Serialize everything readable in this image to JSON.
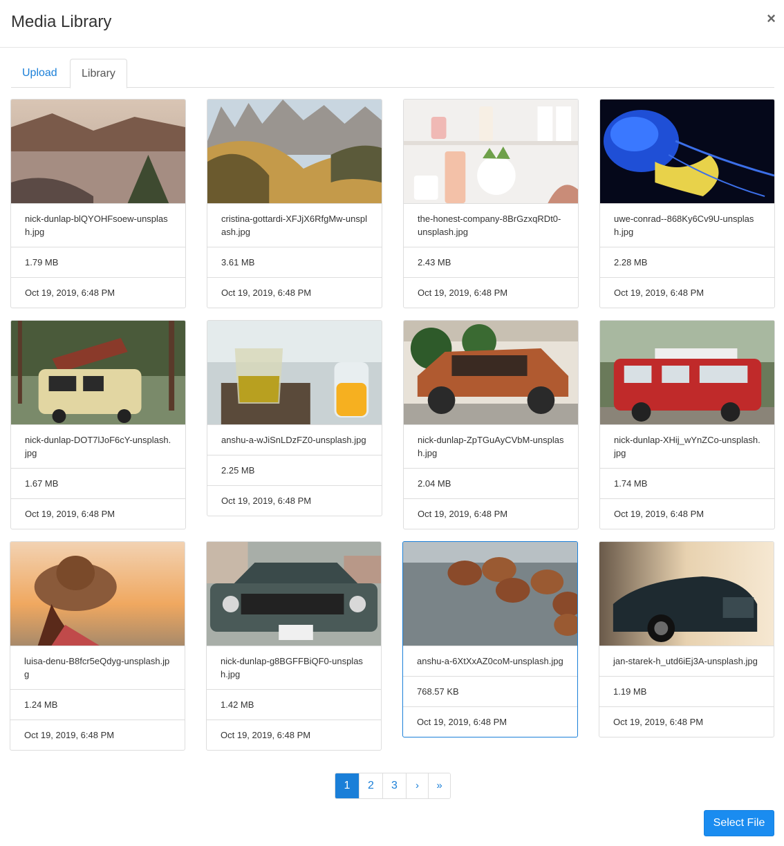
{
  "modal": {
    "title": "Media Library",
    "close_label": "×"
  },
  "tabs": [
    {
      "label": "Upload"
    },
    {
      "label": "Library"
    }
  ],
  "items": [
    {
      "name": "nick-dunlap-blQYOHFsoew-unsplash.jpg",
      "size": "1.79 MB",
      "date": "Oct 19, 2019, 6:48 PM"
    },
    {
      "name": "cristina-gottardi-XFJjX6RfgMw-unsplash.jpg",
      "size": "3.61 MB",
      "date": "Oct 19, 2019, 6:48 PM"
    },
    {
      "name": "the-honest-company-8BrGzxqRDt0-unsplash.jpg",
      "size": "2.43 MB",
      "date": "Oct 19, 2019, 6:48 PM"
    },
    {
      "name": "uwe-conrad--868Ky6Cv9U-unsplash.jpg",
      "size": "2.28 MB",
      "date": "Oct 19, 2019, 6:48 PM"
    },
    {
      "name": "nick-dunlap-DOT7lJoF6cY-unsplash.jpg",
      "size": "1.67 MB",
      "date": "Oct 19, 2019, 6:48 PM"
    },
    {
      "name": "anshu-a-wJiSnLDzFZ0-unsplash.jpg",
      "size": "2.25 MB",
      "date": "Oct 19, 2019, 6:48 PM"
    },
    {
      "name": "nick-dunlap-ZpTGuAyCVbM-unsplash.jpg",
      "size": "2.04 MB",
      "date": "Oct 19, 2019, 6:48 PM"
    },
    {
      "name": "nick-dunlap-XHij_wYnZCo-unsplash.jpg",
      "size": "1.74 MB",
      "date": "Oct 19, 2019, 6:48 PM"
    },
    {
      "name": "luisa-denu-B8fcr5eQdyg-unsplash.jpg",
      "size": "1.24 MB",
      "date": "Oct 19, 2019, 6:48 PM"
    },
    {
      "name": "nick-dunlap-g8BGFFBiQF0-unsplash.jpg",
      "size": "1.42 MB",
      "date": "Oct 19, 2019, 6:48 PM"
    },
    {
      "name": "anshu-a-6XtXxAZ0coM-unsplash.jpg",
      "size": "768.57 KB",
      "date": "Oct 19, 2019, 6:48 PM"
    },
    {
      "name": "jan-starek-h_utd6iEj3A-unsplash.jpg",
      "size": "1.19 MB",
      "date": "Oct 19, 2019, 6:48 PM"
    }
  ],
  "pagination": {
    "pages": [
      "1",
      "2",
      "3"
    ],
    "next": "›",
    "last": "»"
  },
  "footer": {
    "select_label": "Select File"
  },
  "colors": {
    "accent": "#1a7fd8",
    "border": "#dddddd"
  }
}
